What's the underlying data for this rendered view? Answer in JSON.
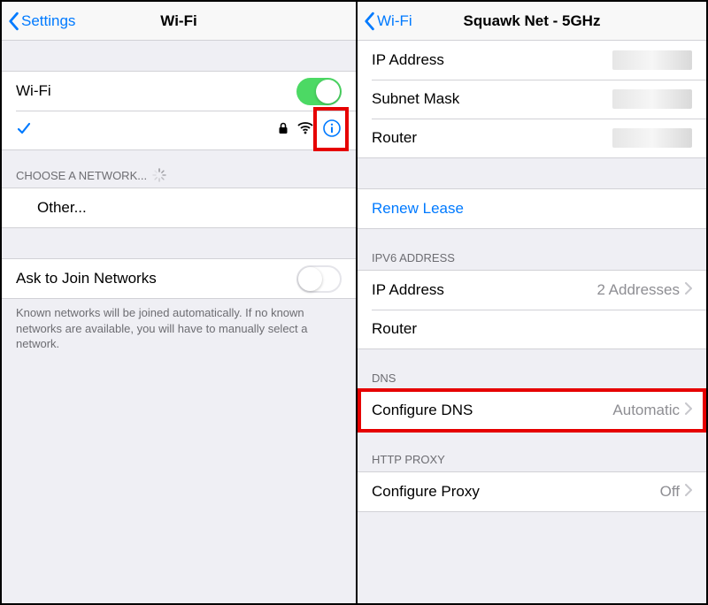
{
  "left": {
    "back_label": "Settings",
    "title": "Wi-Fi",
    "wifi_toggle_label": "Wi-Fi",
    "wifi_toggle_on": true,
    "connected_network": "",
    "choose_header": "CHOOSE A NETWORK...",
    "other_label": "Other...",
    "ask_label": "Ask to Join Networks",
    "ask_on": false,
    "ask_footer": "Known networks will be joined automatically. If no known networks are available, you will have to manually select a network."
  },
  "right": {
    "back_label": "Wi-Fi",
    "title": "Squawk Net - 5GHz",
    "ipv4": {
      "ip_label": "IP Address",
      "subnet_label": "Subnet Mask",
      "router_label": "Router"
    },
    "renew_label": "Renew Lease",
    "ipv6_header": "IPV6 ADDRESS",
    "ipv6": {
      "ip_label": "IP Address",
      "ip_value": "2 Addresses",
      "router_label": "Router"
    },
    "dns_header": "DNS",
    "dns": {
      "label": "Configure DNS",
      "value": "Automatic"
    },
    "proxy_header": "HTTP PROXY",
    "proxy": {
      "label": "Configure Proxy",
      "value": "Off"
    }
  }
}
